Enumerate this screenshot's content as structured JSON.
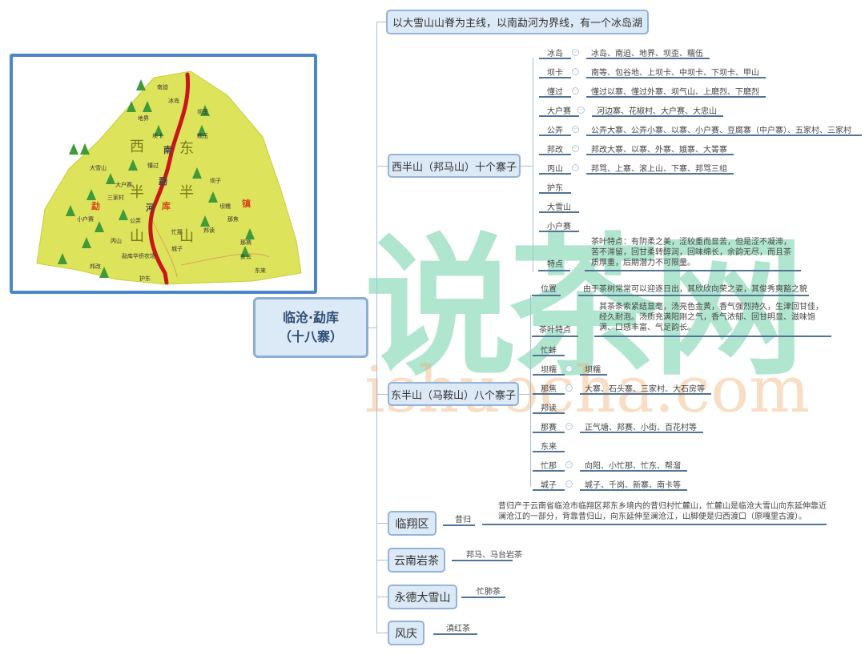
{
  "root": {
    "line1": "临沧·勐库",
    "line2": "（十八寨）"
  },
  "top_note": "以大雪山山脊为主线，以南勐河为界线，有一个冰岛湖",
  "west": {
    "label": "西半山（邦马山）十个寨子",
    "items": [
      {
        "name": "冰岛",
        "value": "冰岛、南迫、地界、坝歪、糯伍"
      },
      {
        "name": "坝卡",
        "value": "南等、包谷地、上坝卡、中坝卡、下坝卡、甲山"
      },
      {
        "name": "懂过",
        "value": "懂过以寨、懂过外寨、坝气山、上磨烈、下磨烈"
      },
      {
        "name": "大户赛",
        "value": "河边寨、花椒村、大户赛、大忠山"
      },
      {
        "name": "公弄",
        "value": "公弄大寨、公弄小寨、以寨、小户赛、豆腐寨（中户寨）、五家村、三家村"
      },
      {
        "name": "邦改",
        "value": "邦改大寨、以寨、外寨、娥寨、大箐寨"
      },
      {
        "name": "丙山",
        "value": "邦骂、上寨、滚上山、下寨、邦骂三组"
      },
      {
        "name": "护东",
        "value": ""
      },
      {
        "name": "大雪山",
        "value": ""
      },
      {
        "name": "小户赛",
        "value": ""
      }
    ],
    "feature": {
      "name": "特点",
      "value": "茶叶特点：有阴柔之美，涩较重而显苦，但是涩不凝滞，苦不滞留，回甘柔转醇润，回味绵长，余韵无尽，而且茶质厚重，后期潜力不可限量。"
    }
  },
  "east": {
    "label": "东半山（马鞍山）八个寨子",
    "location": {
      "name": "位置",
      "value": "由于茶树常常可以迎逐日出，其欣欣向荣之姿，其俊秀爽豁之貌"
    },
    "feature": {
      "name": "茶叶特点",
      "value": "其茶条索紧结显毫，汤亮色金黄，香气强烈持久，生津回甘佳，经久耐泡。汤质充满阳刚之气，香气浓郁、回甘明显、滋味饱满、口感丰富、气足韵长。"
    },
    "items": [
      {
        "name": "忙蚌",
        "value": ""
      },
      {
        "name": "坝糯",
        "value": "坝糯"
      },
      {
        "name": "那焦",
        "value": "大寨、石头寨、三家村、大石房等"
      },
      {
        "name": "邦读",
        "value": ""
      },
      {
        "name": "那赛",
        "value": "正气塘、邦赛、小街、百花村等"
      },
      {
        "name": "东来",
        "value": ""
      },
      {
        "name": "忙那",
        "value": "向阳、小忙那、忙东、帮溜"
      },
      {
        "name": "城子",
        "value": "城子、千岗、新寨、南卡等"
      }
    ]
  },
  "linxiang": {
    "label": "临翔区",
    "child": "昔归",
    "value": "昔归产于云南省临沧市临翔区邦东乡境内的昔归村忙麓山，忙麓山是临沧大雪山向东延伸靠近澜沧江的一部分，背靠昔归山，向东延伸至澜沧江，山脚便是归西渡口（原嘎里古渡）。"
  },
  "yannan": {
    "label": "云南岩茶",
    "child": "邦马、马台岩茶"
  },
  "yongde": {
    "label": "永德大雪山",
    "child": "忙肺茶"
  },
  "fengqing": {
    "label": "风庆",
    "child": "滇红茶"
  },
  "map": {
    "big": [
      "西",
      "东",
      "半",
      "半",
      "山",
      "山"
    ],
    "red": [
      "勐",
      "库",
      "镇"
    ],
    "river": [
      "南",
      "勐",
      "河"
    ],
    "places": [
      "南迫",
      "冰岛",
      "地界",
      "坝歪",
      "坝卡",
      "糯伍",
      "大雪山",
      "懂过",
      "大户赛",
      "坝子",
      "三家村",
      "坝糯",
      "小户赛",
      "公弄",
      "那焦",
      "邦读",
      "忙那",
      "丙山",
      "那赛",
      "城子",
      "勐库华侨农场",
      "亥公",
      "邦改",
      "护东",
      "东来"
    ]
  },
  "watermark": {
    "cn": "说茶网",
    "en": "ishuocha.com"
  },
  "colors": {
    "node_fill": "#dce9f6",
    "node_border": "#94b3d6",
    "underline": "#4f7399",
    "map_land": "#dde35a",
    "river": "#c8161d",
    "frame": "#4a86c8"
  }
}
